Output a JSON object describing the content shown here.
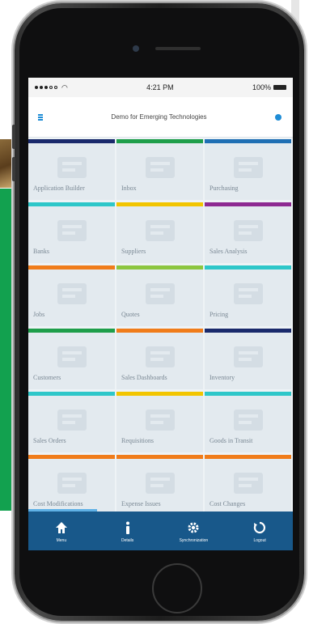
{
  "status_bar": {
    "time": "4:21 PM",
    "battery": "100%"
  },
  "header": {
    "title": "Demo for Emerging Technologies"
  },
  "tiles": [
    {
      "label": "Application Builder",
      "color": "#1a2a6c",
      "icon": "user-icon"
    },
    {
      "label": "Inbox",
      "color": "#1e9e4a",
      "icon": "inbox-icon"
    },
    {
      "label": "Purchasing",
      "color": "#1f6fb4",
      "icon": "browser-window-icon"
    },
    {
      "label": "Banks",
      "color": "#2ec7c9",
      "icon": "bank-icon"
    },
    {
      "label": "Suppliers",
      "color": "#f2c500",
      "icon": "boxes-icon"
    },
    {
      "label": "Sales Analysis",
      "color": "#8e2a92",
      "icon": "trend-chart-icon"
    },
    {
      "label": "Jobs",
      "color": "#f07c1a",
      "icon": "calendar-icon"
    },
    {
      "label": "Quotes",
      "color": "#8cc63f",
      "icon": "document-icon"
    },
    {
      "label": "Pricing",
      "color": "#2ec7c9",
      "icon": "price-tag-icon"
    },
    {
      "label": "Customers",
      "color": "#1e9e4a",
      "icon": "money-icon"
    },
    {
      "label": "Sales Dashboards",
      "color": "#f07c1a",
      "icon": "calculator-icon"
    },
    {
      "label": "Inventory",
      "color": "#1a2a6c",
      "icon": "box-icon"
    },
    {
      "label": "Sales Orders",
      "color": "#2ec7c9",
      "icon": "shopping-bag-icon"
    },
    {
      "label": "Requisitions",
      "color": "#f2c500",
      "icon": "package-icon"
    },
    {
      "label": "Goods in Transit",
      "color": "#2ec7c9",
      "icon": "truck-icon"
    },
    {
      "label": "Cost Modifications",
      "color": "#f07c1a",
      "icon": "register-icon"
    },
    {
      "label": "Expense Issues",
      "color": "#f07c1a",
      "icon": "checklist-icon"
    },
    {
      "label": "Cost Changes",
      "color": "#f07c1a",
      "icon": "cash-icon"
    }
  ],
  "tabbar": {
    "background": "#18588a",
    "items": [
      {
        "label": "Menu",
        "icon": "home-icon"
      },
      {
        "label": "Details",
        "icon": "info-icon"
      },
      {
        "label": "Synchronization",
        "icon": "gear-icon"
      },
      {
        "label": "Logout",
        "icon": "logout-icon"
      }
    ]
  }
}
